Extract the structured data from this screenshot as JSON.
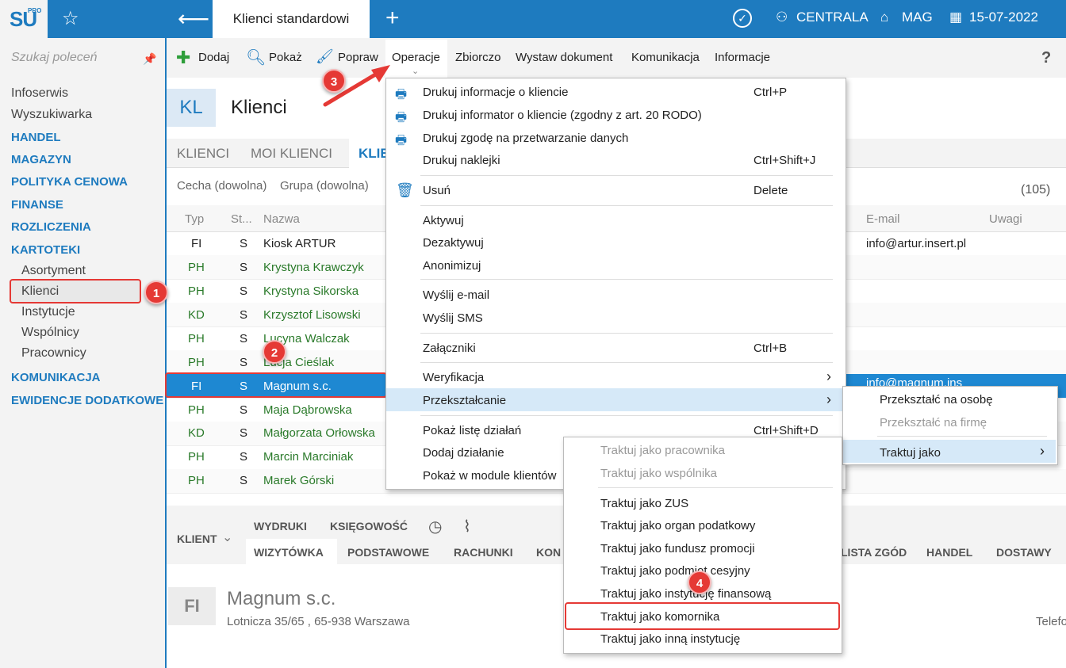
{
  "logo": {
    "text": "SU",
    "sup": "PRO"
  },
  "topbar": {
    "active_tab": "Klienci standardowi",
    "centrala": "CENTRALA",
    "mag": "MAG",
    "date": "15-07-2022"
  },
  "sidebar": {
    "search_placeholder": "Szukaj poleceń",
    "items": [
      "Infoserwis",
      "Wyszukiwarka"
    ],
    "cats1": [
      "HANDEL",
      "MAGAZYN",
      "POLITYKA CENOWA",
      "FINANSE",
      "ROZLICZENIA",
      "KARTOTEKI"
    ],
    "kartoteki": [
      "Asortyment",
      "Klienci",
      "Instytucje",
      "Wspólnicy",
      "Pracownicy"
    ],
    "cats2": [
      "KOMUNIKACJA",
      "EWIDENCJE DODATKOWE"
    ]
  },
  "toolbar": {
    "dodaj": "Dodaj",
    "pokaz": "Pokaż",
    "popraw": "Popraw",
    "operacje": "Operacje",
    "zbiorczo": "Zbiorczo",
    "wystaw": "Wystaw dokument",
    "komunikacja": "Komunikacja",
    "informacje": "Informacje",
    "help": "?"
  },
  "page": {
    "badge": "KL",
    "title": "Klienci"
  },
  "content_tabs": {
    "t1": "KLIENCI",
    "t2": "MOI KLIENCI",
    "t3": "KLIE"
  },
  "filters": {
    "cecha": "Cecha (dowolna)",
    "grupa": "Grupa (dowolna)",
    "count": "(105)"
  },
  "table": {
    "headers": {
      "typ": "Typ",
      "st": "St...",
      "nazwa": "Nazwa",
      "email": "E-mail",
      "uwagi": "Uwagi"
    },
    "rows": [
      {
        "typ": "FI",
        "st": "S",
        "nazwa": "Kiosk ARTUR",
        "email": "info@artur.insert.pl"
      },
      {
        "typ": "PH",
        "st": "S",
        "nazwa": "Krystyna Krawczyk",
        "email": ""
      },
      {
        "typ": "PH",
        "st": "S",
        "nazwa": "Krystyna Sikorska",
        "email": ""
      },
      {
        "typ": "KD",
        "st": "S",
        "nazwa": "Krzysztof Lisowski",
        "email": ""
      },
      {
        "typ": "PH",
        "st": "S",
        "nazwa": "Lucyna Walczak",
        "email": ""
      },
      {
        "typ": "PH",
        "st": "S",
        "nazwa": "Lucja Cieślak",
        "email": ""
      },
      {
        "typ": "FI",
        "st": "S",
        "nazwa": "Magnum s.c.",
        "email": "info@magnum.ins"
      },
      {
        "typ": "PH",
        "st": "S",
        "nazwa": "Maja Dąbrowska",
        "email": ""
      },
      {
        "typ": "KD",
        "st": "S",
        "nazwa": "Małgorzata Orłowska",
        "email": ""
      },
      {
        "typ": "PH",
        "st": "S",
        "nazwa": "Marcin Marciniak",
        "email": ""
      },
      {
        "typ": "PH",
        "st": "S",
        "nazwa": "Marek Górski",
        "email": ""
      }
    ]
  },
  "menu_operacje": {
    "items": [
      {
        "label": "Drukuj informacje o kliencie",
        "shortcut": "Ctrl+P"
      },
      {
        "label": "Drukuj informator o kliencie (zgodny z art. 20 RODO)",
        "shortcut": ""
      },
      {
        "label": "Drukuj zgodę na przetwarzanie danych",
        "shortcut": ""
      },
      {
        "label": "Drukuj naklejki",
        "shortcut": "Ctrl+Shift+J"
      },
      {
        "label": "Usuń",
        "shortcut": "Delete"
      },
      {
        "label": "Aktywuj",
        "shortcut": ""
      },
      {
        "label": "Dezaktywuj",
        "shortcut": ""
      },
      {
        "label": "Anonimizuj",
        "shortcut": ""
      },
      {
        "label": "Wyślij e-mail",
        "shortcut": ""
      },
      {
        "label": "Wyślij SMS",
        "shortcut": ""
      },
      {
        "label": "Załączniki",
        "shortcut": "Ctrl+B"
      },
      {
        "label": "Weryfikacja",
        "shortcut": "›"
      },
      {
        "label": "Przekształcanie",
        "shortcut": "›"
      },
      {
        "label": "Pokaż listę działań",
        "shortcut": "Ctrl+Shift+D"
      },
      {
        "label": "Dodaj działanie",
        "shortcut": ""
      },
      {
        "label": "Pokaż w module klientów",
        "shortcut": ""
      }
    ]
  },
  "menu_przeksztalcanie": {
    "na_osobe": "Przekształć na osobę",
    "na_firme": "Przekształć na firmę",
    "traktuj": "Traktuj jako",
    "arrow": "›"
  },
  "menu_traktuj": {
    "items": [
      "Traktuj jako pracownika",
      "Traktuj jako wspólnika",
      "Traktuj jako ZUS",
      "Traktuj jako organ podatkowy",
      "Traktuj jako fundusz promocji",
      "Traktuj jako podmiot cesyjny",
      "Traktuj jako instytucję finansową",
      "Traktuj jako komornika",
      "Traktuj jako inną instytucję"
    ]
  },
  "badges": {
    "b1": "1",
    "b2": "2",
    "b3": "3",
    "b4": "4"
  },
  "bottom": {
    "klient": "KLIENT",
    "wydruki": "WYDRUKI",
    "ksiegowosc": "KSIĘGOWOŚĆ",
    "tabs": [
      "WIZYTÓWKA",
      "PODSTAWOWE",
      "RACHUNKI",
      "KON"
    ],
    "tabs_right": [
      "LISTA ZGÓD",
      "HANDEL",
      "DOSTAWY"
    ],
    "badge": "FI",
    "name": "Magnum s.c.",
    "address": "Lotnicza  35/65 , 65-938 Warszawa",
    "telefon": "Telefo"
  }
}
